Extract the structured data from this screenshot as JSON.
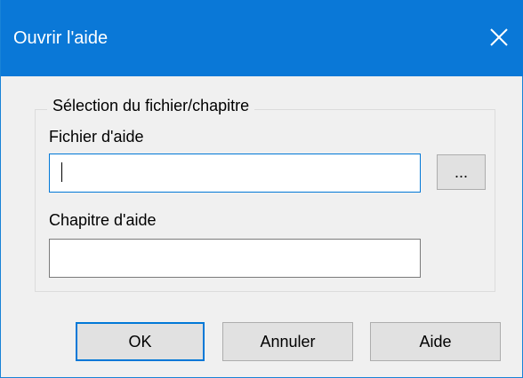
{
  "window": {
    "title": "Ouvrir l'aide",
    "close_icon": "close-icon"
  },
  "group": {
    "legend": "Sélection du fichier/chapitre",
    "help_file_label": "Fichier d'aide",
    "help_file_value": "",
    "browse_label": "...",
    "help_chapter_label": "Chapitre d'aide",
    "help_chapter_value": ""
  },
  "buttons": {
    "ok_label": "OK",
    "cancel_label": "Annuler",
    "help_label": "Aide"
  },
  "colors": {
    "titlebar": "#0a78d7",
    "focus_border": "#0078d7",
    "dialog_background": "#f0f0f0"
  }
}
